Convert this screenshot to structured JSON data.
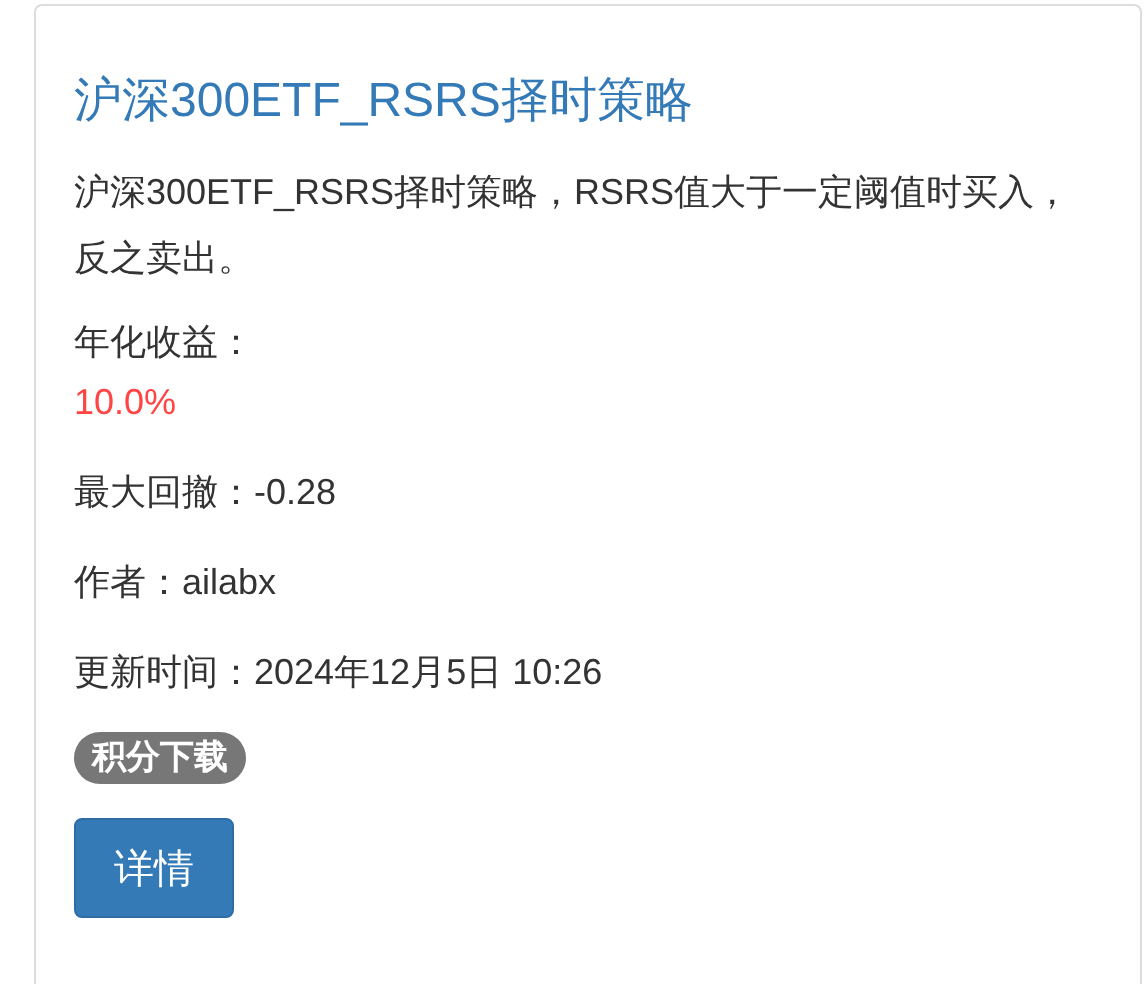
{
  "card": {
    "title": "沪深300ETF_RSRS择时策略",
    "description": "沪深300ETF_RSRS择时策略，RSRS值大于一定阈值时买入，反之卖出。",
    "fields": [
      {
        "kind": "stacked",
        "label": "年化收益：",
        "value": "10.0%"
      },
      {
        "kind": "inline",
        "label": "最大回撤：",
        "value": "-0.28"
      },
      {
        "kind": "inline",
        "label": "作者：",
        "value": "ailabx"
      },
      {
        "kind": "inline",
        "label": "更新时间：",
        "value": "2024年12月5日 10:26"
      }
    ],
    "badge": "积分下载",
    "button": "详情"
  }
}
